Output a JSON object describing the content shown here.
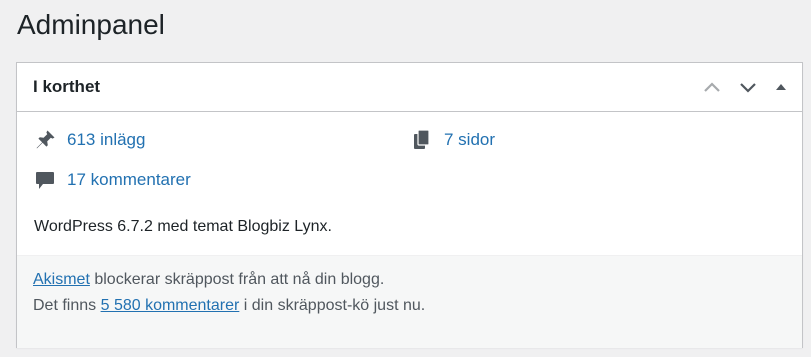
{
  "page": {
    "title": "Adminpanel"
  },
  "widget": {
    "title": "I korthet",
    "controls": {
      "move_up_icon": "chevron-up-icon",
      "move_down_icon": "chevron-down-icon",
      "toggle_icon": "triangle-up-icon"
    },
    "items": [
      {
        "icon": "pushpin-icon",
        "label": "613 inlägg"
      },
      {
        "icon": "pages-icon",
        "label": "7 sidor"
      },
      {
        "icon": "comment-icon",
        "label": "17 kommentarer"
      }
    ],
    "version_text": "WordPress 6.7.2 med temat Blogbiz Lynx.",
    "footer": {
      "akismet_link": "Akismet",
      "akismet_text": " blockerar skräppost från att nå din blogg.",
      "spam_prefix": "Det finns ",
      "spam_link": "5 580 kommentarer",
      "spam_suffix": " i din skräppost-kö just nu."
    }
  },
  "colors": {
    "background": "#f0f0f1",
    "link": "#2271b1",
    "text": "#1d2327",
    "muted_text": "#50575e",
    "icon": "#50575e",
    "footer_bg": "#f6f7f7",
    "border": "#c3c4c7"
  }
}
